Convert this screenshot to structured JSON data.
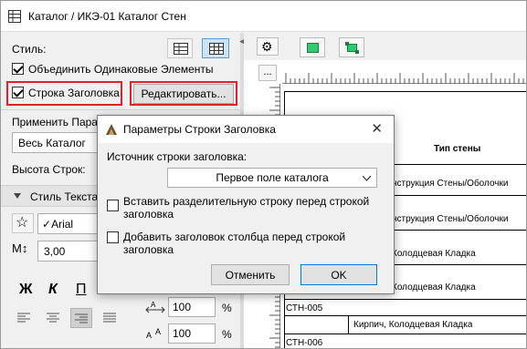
{
  "window": {
    "title": "Каталог / ИКЭ-01 Каталог Стен"
  },
  "left": {
    "style_label": "Стиль:",
    "merge_label": "Объединить Одинаковые Элементы",
    "header_row_label": "Строка Заголовка",
    "edit_button": "Редактировать...",
    "apply_label": "Применить Пара",
    "apply_value": "Весь Каталог",
    "row_height_label": "Высота Строк:",
    "text_style_section": "Стиль Текста",
    "font_value": "Arial",
    "font_size_value": "3,00",
    "bold_label": "Ж",
    "italic_label": "К",
    "underline_label": "П",
    "width_value": "100",
    "height_value": "100",
    "percent": "%"
  },
  "sheet": {
    "header": "Тип стены",
    "rows": [
      "нструкция Стены/Оболочки",
      "нструкция Стены/Оболочки",
      "Колодцевая Кладка",
      "Колодцевая Кладка",
      "СТН-005",
      "Кирпич, Колодцевая Кладка",
      "СТН-006"
    ]
  },
  "dialog": {
    "title": "Параметры Строки Заголовка",
    "source_label": "Источник строки заголовка:",
    "source_value": "Первое поле каталога",
    "option1": "Вставить разделительную строку перед строкой заголовка",
    "option2": "Добавить заголовок столбца перед строкой заголовка",
    "cancel_button": "Отменить",
    "ok_button": "OK"
  }
}
